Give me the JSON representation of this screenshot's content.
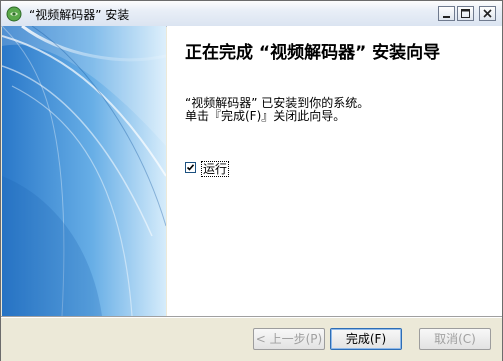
{
  "window": {
    "title": "“视频解码器” 安装",
    "app_icon": "installer-icon",
    "controls": {
      "minimize": "minimize-icon",
      "maximize": "maximize-icon",
      "close": "close-icon"
    }
  },
  "content": {
    "heading": "正在完成 “视频解码器” 安装向导",
    "message_line1": "“视频解码器” 已安装到你的系统。",
    "message_line2": "单击『完成(F)』关闭此向导。",
    "run_checkbox": {
      "label": "运行",
      "checked": true
    }
  },
  "buttons": {
    "back": "< 上一步(P)",
    "finish": "完成(F)",
    "cancel": "取消(C)"
  },
  "colors": {
    "side_panel_blue": "#3f8ed6",
    "content_bg": "#ffffff",
    "dialog_bg": "#ece9d8"
  }
}
